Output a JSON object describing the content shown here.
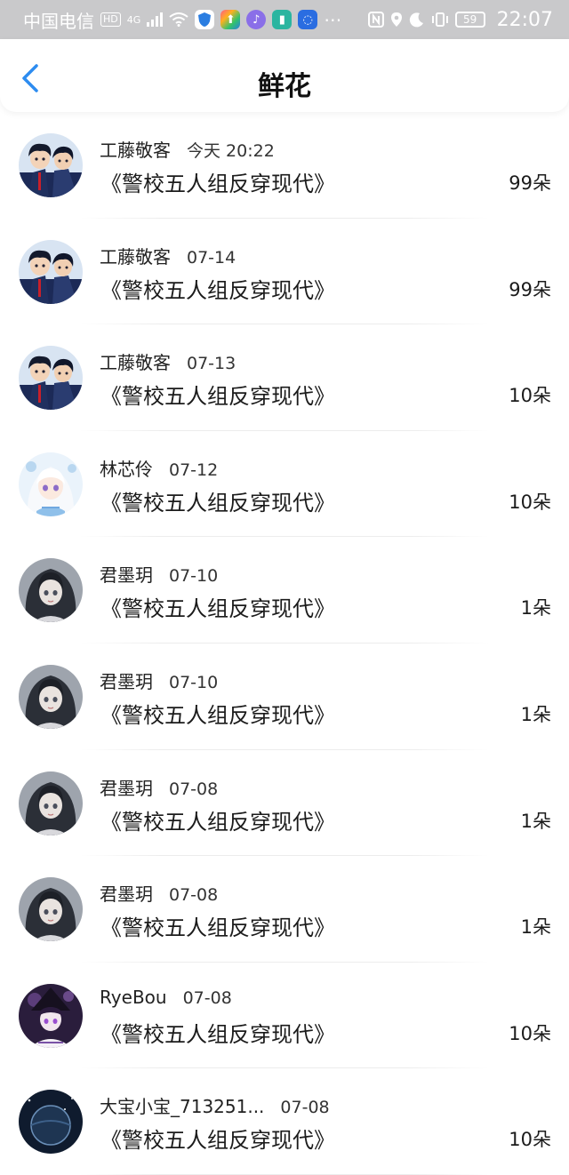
{
  "status_bar": {
    "carrier": "中国电信",
    "hd": "HD",
    "network": "4G",
    "battery": "59",
    "time": "22:07",
    "colors": {
      "background": "#c9c9cb"
    }
  },
  "header": {
    "title": "鲜花",
    "back_icon": "chevron-left-icon",
    "accent": "#2d8cf0"
  },
  "items": [
    {
      "user": "工藤敬客",
      "date": "今天 20:22",
      "book": "《警校五人组反穿现代》",
      "count": "99朵",
      "avatar": "anime-boys"
    },
    {
      "user": "工藤敬客",
      "date": "07-14",
      "book": "《警校五人组反穿现代》",
      "count": "99朵",
      "avatar": "anime-boys"
    },
    {
      "user": "工藤敬客",
      "date": "07-13",
      "book": "《警校五人组反穿现代》",
      "count": "10朵",
      "avatar": "anime-boys"
    },
    {
      "user": "林芯伶",
      "date": "07-12",
      "book": "《警校五人组反穿现代》",
      "count": "10朵",
      "avatar": "white-hair-girl"
    },
    {
      "user": "君墨玥",
      "date": "07-10",
      "book": "《警校五人组反穿现代》",
      "count": "1朵",
      "avatar": "dark-hair-girl"
    },
    {
      "user": "君墨玥",
      "date": "07-10",
      "book": "《警校五人组反穿现代》",
      "count": "1朵",
      "avatar": "dark-hair-girl"
    },
    {
      "user": "君墨玥",
      "date": "07-08",
      "book": "《警校五人组反穿现代》",
      "count": "1朵",
      "avatar": "dark-hair-girl"
    },
    {
      "user": "君墨玥",
      "date": "07-08",
      "book": "《警校五人组反穿现代》",
      "count": "1朵",
      "avatar": "dark-hair-girl"
    },
    {
      "user": "RyeBou",
      "date": "07-08",
      "book": "《警校五人组反穿现代》",
      "count": "10朵",
      "avatar": "purple-witch"
    },
    {
      "user": "大宝小宝_713251...",
      "date": "07-08",
      "book": "《警校五人组反穿现代》",
      "count": "10朵",
      "avatar": "night-planet"
    }
  ]
}
